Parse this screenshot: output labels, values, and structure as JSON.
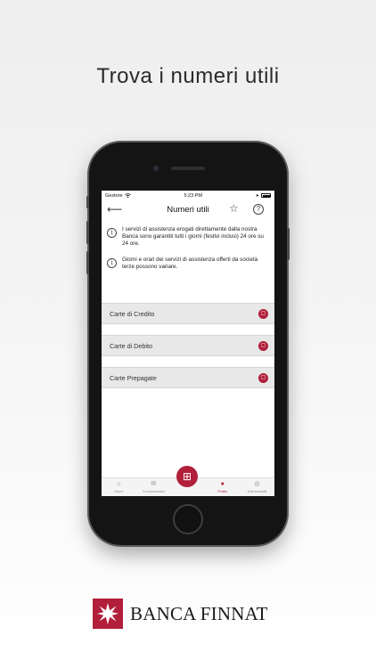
{
  "headline": "Trova i numeri utili",
  "status_bar": {
    "carrier": "Gestore",
    "wifi_icon": "wifi-icon",
    "time": "5:23 PM",
    "location_icon": "location-arrow-icon",
    "battery_icon": "battery-icon"
  },
  "nav": {
    "back_icon": "arrow-left-icon",
    "title": "Numeri utili",
    "favorite_icon": "star-icon",
    "help_label": "?"
  },
  "info": [
    {
      "icon": "info-icon",
      "symbol": "i",
      "text": "I servizi di assistenza erogati direttamente dalla nostra Banca sono garantiti tutti i giorni (festivi inclusi) 24 ore su 24 ore."
    },
    {
      "icon": "info-icon",
      "symbol": "i",
      "text": "Giorni e orari dei servizi di assistenza offerti da società terze possono variare."
    }
  ],
  "cards": [
    {
      "label": "Carte di Credito",
      "icon": "expand-icon"
    },
    {
      "label": "Carte di Debito",
      "icon": "expand-icon"
    },
    {
      "label": "Carte Prepagate",
      "icon": "expand-icon"
    }
  ],
  "tabs": [
    {
      "label": "Home",
      "icon": "home-icon"
    },
    {
      "label": "Comunicazioni",
      "icon": "mail-icon"
    },
    {
      "label": "",
      "icon": "grid-icon"
    },
    {
      "label": "Profilo",
      "icon": "profile-icon"
    },
    {
      "label": "Dati sensibili",
      "icon": "eye-icon"
    }
  ],
  "brand": {
    "name": "BANCA FINNAT",
    "logo_icon": "star-logo-icon"
  },
  "colors": {
    "accent": "#b11f3a",
    "card_bg": "#e8e8e8"
  }
}
